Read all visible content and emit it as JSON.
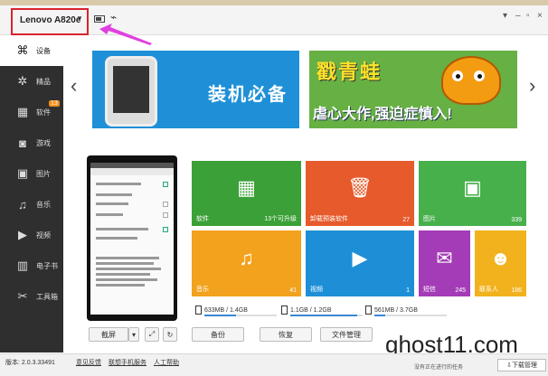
{
  "title_bar": {
    "device_name": "Lenovo A820e",
    "controls": [
      "▾",
      "–",
      "▫",
      "×"
    ]
  },
  "sidebar": {
    "items": [
      {
        "label": "设备",
        "icon": "device-icon",
        "active": true
      },
      {
        "label": "精品",
        "icon": "star-icon"
      },
      {
        "label": "软件",
        "icon": "apps-icon",
        "badge": "13"
      },
      {
        "label": "游戏",
        "icon": "gamepad-icon"
      },
      {
        "label": "图片",
        "icon": "picture-icon"
      },
      {
        "label": "音乐",
        "icon": "music-note-icon"
      },
      {
        "label": "视频",
        "icon": "video-icon"
      },
      {
        "label": "电子书",
        "icon": "book-icon"
      },
      {
        "label": "工具箱",
        "icon": "tools-icon"
      }
    ]
  },
  "banners": [
    {
      "text": "装机必备"
    },
    {
      "title": "戳青蛙",
      "subtitle": "虐心大作,强迫症慎入!"
    }
  ],
  "tiles": [
    {
      "label": "软件",
      "count": "13个可升级",
      "color": "#3aa037",
      "icon": "apps-icon"
    },
    {
      "label": "卸载预装软件",
      "count": "27",
      "color": "#e65a2b",
      "icon": "trash-icon"
    },
    {
      "label": "图片",
      "count": "339",
      "color": "#47b04b",
      "icon": "picture-icon"
    },
    {
      "label": "音乐",
      "count": "41",
      "color": "#f2a21d",
      "icon": "music-note-icon"
    },
    {
      "label": "视频",
      "count": "1",
      "color": "#1e8fd6",
      "icon": "video-icon"
    },
    {
      "label": "短信",
      "count": "245",
      "color": "#a43cb7",
      "icon": "message-icon"
    },
    {
      "label": "联系人",
      "count": "186",
      "color": "#f2b21d",
      "icon": "contact-icon"
    }
  ],
  "storage": [
    {
      "text": "633MB / 1.4GB",
      "used_fraction": 0.44
    },
    {
      "text": "1.1GB / 1.2GB",
      "used_fraction": 0.92
    },
    {
      "text": "561MB / 3.7GB",
      "used_fraction": 0.15
    }
  ],
  "phone_buttons": {
    "screenshot": "截屏",
    "more": "▾",
    "fullscreen": "⤢",
    "refresh": "↻"
  },
  "actions": {
    "backup": "备份",
    "restore": "恢复",
    "files": "文件管理"
  },
  "status": {
    "version": "版本: 2.0.3.33491",
    "feedback": "意见反馈",
    "help_phone": "联想手机服务",
    "manual_help": "人工帮助",
    "no_task": "没有正在进行的任务",
    "download_mgr": "下载管理"
  },
  "watermark": "ghost11.com"
}
